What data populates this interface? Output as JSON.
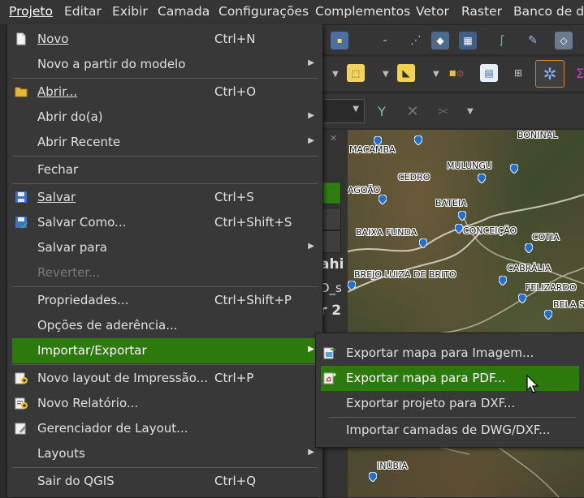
{
  "menubar": {
    "items": [
      {
        "label": "Projeto"
      },
      {
        "label": "Editar"
      },
      {
        "label": "Exibir"
      },
      {
        "label": "Camada"
      },
      {
        "label": "Configurações"
      },
      {
        "label": "Complementos"
      },
      {
        "label": "Vetor"
      },
      {
        "label": "Raster"
      },
      {
        "label": "Banco de da"
      }
    ]
  },
  "project_menu": {
    "items": [
      {
        "label": "Novo",
        "shortcut": "Ctrl+N"
      },
      {
        "label": "Novo a partir do modelo"
      },
      {
        "label": "Abrir...",
        "shortcut": "Ctrl+O"
      },
      {
        "label": "Abrir do(a)"
      },
      {
        "label": "Abrir Recente"
      },
      {
        "label": "Fechar"
      },
      {
        "label": "Salvar",
        "shortcut": "Ctrl+S"
      },
      {
        "label": "Salvar Como...",
        "shortcut": "Ctrl+Shift+S"
      },
      {
        "label": "Salvar para"
      },
      {
        "label": "Reverter..."
      },
      {
        "label": "Propriedades...",
        "shortcut": "Ctrl+Shift+P"
      },
      {
        "label": "Opções de aderência..."
      },
      {
        "label": "Importar/Exportar"
      },
      {
        "label": "Novo layout de Impressão...",
        "shortcut": "Ctrl+P"
      },
      {
        "label": "Novo Relatório..."
      },
      {
        "label": "Gerenciador de Layout..."
      },
      {
        "label": "Layouts"
      },
      {
        "label": "Sair do QGIS",
        "shortcut": "Ctrl+Q"
      }
    ]
  },
  "import_export_submenu": {
    "items": [
      {
        "label": "Exportar mapa para Imagem..."
      },
      {
        "label": "Exportar mapa para PDF..."
      },
      {
        "label": "Exportar projeto para DXF..."
      },
      {
        "label": "Importar camadas de DWG/DXF..."
      }
    ]
  },
  "left_panel": {
    "fragments": [
      "ahi",
      "D_s",
      "r 2"
    ]
  },
  "map": {
    "places": [
      "MACAMBA",
      "BONINAL",
      "MULUNGU",
      "CEDRO",
      "AGOÃO",
      "BATEIA",
      "CONCEIÇÃO",
      "BAIXA FUNDA",
      "COTIA",
      "BREJO LUIZA DE BRITO",
      "CABRÁLIA",
      "FELIZARDO",
      "BELA S",
      "INÚBIA"
    ]
  },
  "colors": {
    "highlight": "#2b7a0b",
    "menu_bg": "#383838",
    "pin": "#1f6fd6"
  }
}
